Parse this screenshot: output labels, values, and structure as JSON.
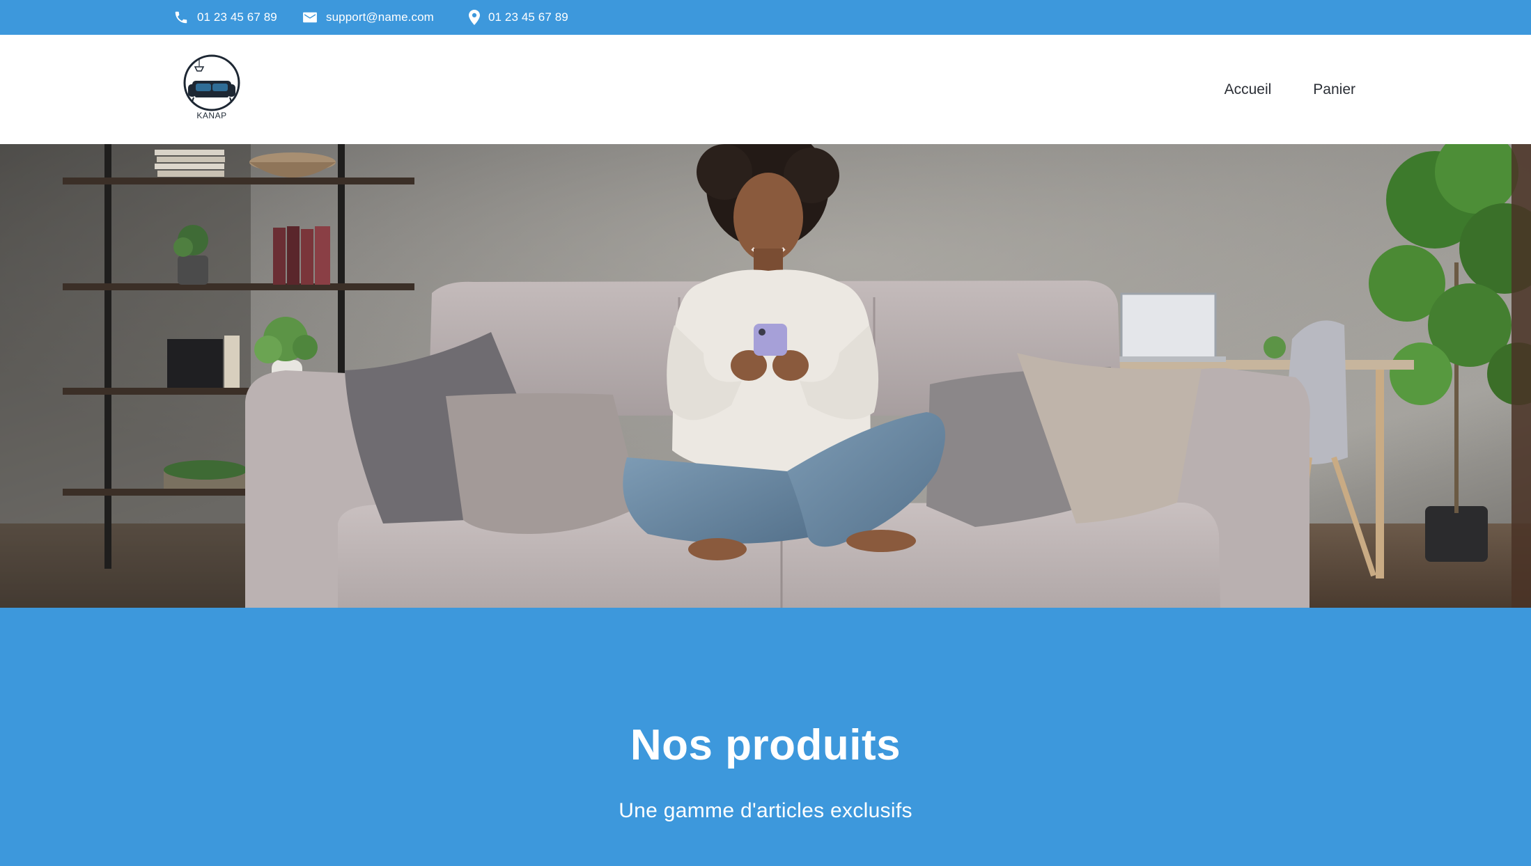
{
  "topbar": {
    "background": "#3d98dc",
    "phone": {
      "icon": "phone-icon",
      "text": "01 23 45 67 89"
    },
    "email": {
      "icon": "mail-icon",
      "text": "support@name.com"
    },
    "address": {
      "icon": "map-pin-icon",
      "text": "01 23 45 67 89"
    }
  },
  "header": {
    "logo": {
      "icon": "sofa-logo-icon",
      "text": "KANAP"
    },
    "nav": [
      {
        "label": "Accueil"
      },
      {
        "label": "Panier"
      }
    ]
  },
  "hero": {
    "image": "woman-on-sofa-with-phone-photo"
  },
  "products": {
    "title": "Nos produits",
    "subtitle": "Une gamme d'articles exclusifs",
    "background": "#3d98dc"
  }
}
